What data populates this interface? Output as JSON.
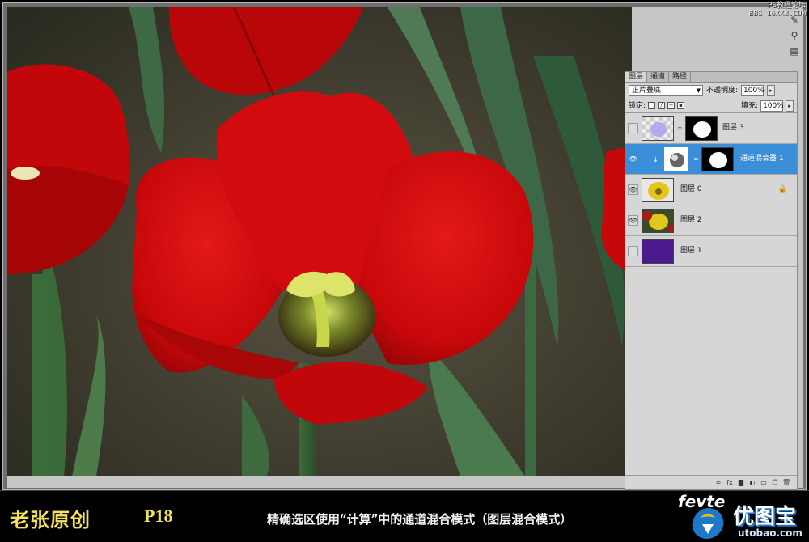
{
  "watermark": {
    "line1": "PS教程论坛",
    "line2": "BBS.16XX8.COM"
  },
  "layers_panel": {
    "tabs": [
      "图层",
      "通道",
      "路径"
    ],
    "blend_mode": "正片叠底",
    "opacity_label": "不透明度:",
    "opacity_value": "100%",
    "lock_label": "锁定:",
    "fill_label": "填充:",
    "fill_value": "100%",
    "layers": [
      {
        "name": "图层 3",
        "visible": false,
        "selected": false,
        "has_mask": true
      },
      {
        "name": "通道混合器 1",
        "visible": true,
        "selected": true,
        "has_mask": true,
        "adjustment": true
      },
      {
        "name": "图层 0",
        "visible": true,
        "selected": false,
        "locked": true
      },
      {
        "name": "图层 2",
        "visible": true,
        "selected": false
      },
      {
        "name": "图层 1",
        "visible": false,
        "selected": false,
        "fill_color": "#4a1a8c"
      }
    ],
    "footer_icons": [
      "link-icon",
      "fx-icon",
      "mask-icon",
      "adjustment-icon",
      "group-icon",
      "new-layer-icon",
      "trash-icon"
    ]
  },
  "caption": {
    "author": "老张原创",
    "page": "P18",
    "description": "精确选区使用“计算”中的通道混合模式（图层混合模式）"
  },
  "logo": {
    "brand": "fevte",
    "site_cn": "优图宝",
    "url": "utobao.com"
  },
  "colors": {
    "tulip_red": "#c8080a",
    "selection_blue": "#3b8ed8",
    "caption_yellow": "#f3e25a",
    "layer1_fill": "#4a1a8c"
  }
}
